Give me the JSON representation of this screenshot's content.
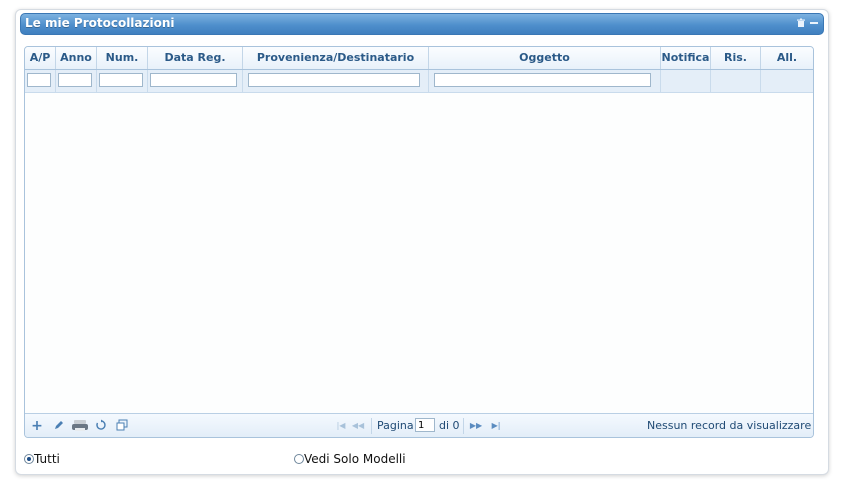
{
  "portlet": {
    "title": "Le mie Protocollazioni",
    "icons": [
      "trash-icon",
      "minimize-icon"
    ]
  },
  "grid": {
    "columns": [
      {
        "key": "ap",
        "label": "A/P"
      },
      {
        "key": "anno",
        "label": "Anno"
      },
      {
        "key": "num",
        "label": "Num."
      },
      {
        "key": "data_reg",
        "label": "Data Reg."
      },
      {
        "key": "provenienza",
        "label": "Provenienza/Destinatario"
      },
      {
        "key": "oggetto",
        "label": "Oggetto"
      },
      {
        "key": "notifica",
        "label": "Notifica"
      },
      {
        "key": "ris",
        "label": "Ris."
      },
      {
        "key": "all",
        "label": "All."
      }
    ],
    "filters": {
      "ap": "",
      "anno": "",
      "num": "",
      "data_reg": "",
      "provenienza": "",
      "oggetto": ""
    },
    "rows": []
  },
  "pager": {
    "tools": [
      "add-icon",
      "edit-icon",
      "print-icon",
      "refresh-icon",
      "columns-icon"
    ],
    "page_label": "Pagina",
    "page_value": "1",
    "of_label": "di 0",
    "status": "Nessun record da visualizzare"
  },
  "filter_options": [
    {
      "label": "Tutti",
      "selected": true
    },
    {
      "label": "Vedi Solo Modelli",
      "selected": false
    }
  ]
}
